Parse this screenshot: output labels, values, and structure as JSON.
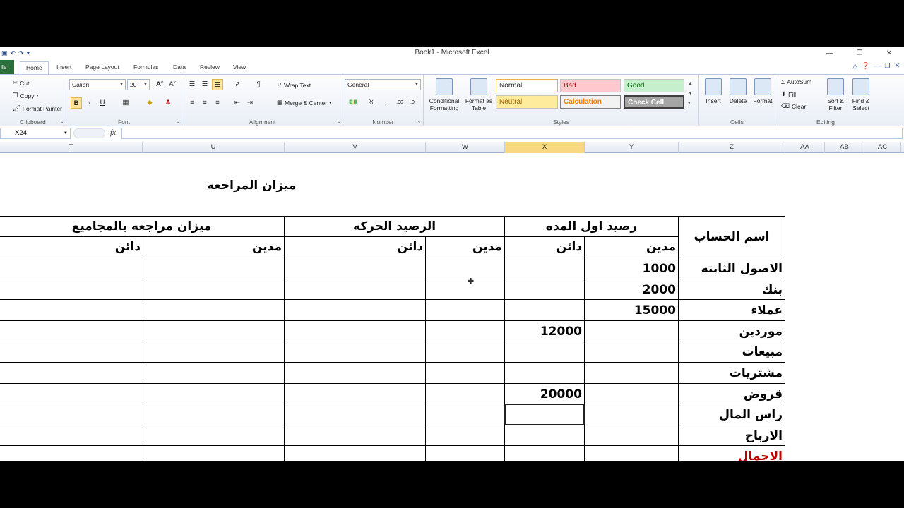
{
  "window": {
    "title": "Book1 - Microsoft Excel"
  },
  "file_tab": "ile",
  "tabs": [
    "Home",
    "Insert",
    "Page Layout",
    "Formulas",
    "Data",
    "Review",
    "View"
  ],
  "clipboard": {
    "cut": "Cut",
    "copy": "Copy",
    "format_painter": "Format Painter",
    "label": "Clipboard"
  },
  "font": {
    "name": "Calibri",
    "size": "20",
    "label": "Font"
  },
  "alignment": {
    "wrap": "Wrap Text",
    "merge": "Merge & Center",
    "label": "Alignment"
  },
  "number": {
    "format": "General",
    "label": "Number"
  },
  "styles": {
    "conditional": "Conditional Formatting",
    "format_table": "Format as Table",
    "normal": "Normal",
    "bad": "Bad",
    "good": "Good",
    "neutral": "Neutral",
    "calculation": "Calculation",
    "check_cell": "Check Cell",
    "label": "Styles"
  },
  "cells_group": {
    "insert": "Insert",
    "delete": "Delete",
    "format": "Format",
    "label": "Cells"
  },
  "editing": {
    "autosum": "AutoSum",
    "fill": "Fill",
    "clear": "Clear",
    "sort": "Sort & Filter",
    "find": "Find & Select",
    "label": "Editing"
  },
  "name_box": "X24",
  "columns": [
    "T",
    "U",
    "V",
    "W",
    "X",
    "Y",
    "Z",
    "AA",
    "AB",
    "AC"
  ],
  "selected_column": "X",
  "sheet": {
    "title": "ميزان المراجعه",
    "account_header": "اسم الحساب",
    "opening_balance": "رصيد اول المده",
    "movement_balance": "الرصيد الحركه",
    "trial_balance_totals": "ميزان مراجعه بالمجاميع",
    "debit": "مدين",
    "credit": "دائن",
    "rows": [
      {
        "account": "الاصول الثابته",
        "debit": "1000",
        "credit": ""
      },
      {
        "account": "بنك",
        "debit": "2000",
        "credit": ""
      },
      {
        "account": "عملاء",
        "debit": "15000",
        "credit": ""
      },
      {
        "account": "موردين",
        "debit": "",
        "credit": "12000"
      },
      {
        "account": "مبيعات",
        "debit": "",
        "credit": ""
      },
      {
        "account": "مشتريات",
        "debit": "",
        "credit": ""
      },
      {
        "account": "قروض",
        "debit": "",
        "credit": "20000"
      },
      {
        "account": "راس المال",
        "debit": "",
        "credit": ""
      },
      {
        "account": "الارباح",
        "debit": "",
        "credit": ""
      },
      {
        "account": "الاجمال",
        "debit": "",
        "credit": ""
      }
    ]
  },
  "colors": {
    "file_tab": "#2a6e3a",
    "selected_header": "#f8d981",
    "last_row_text": "#c00000"
  }
}
